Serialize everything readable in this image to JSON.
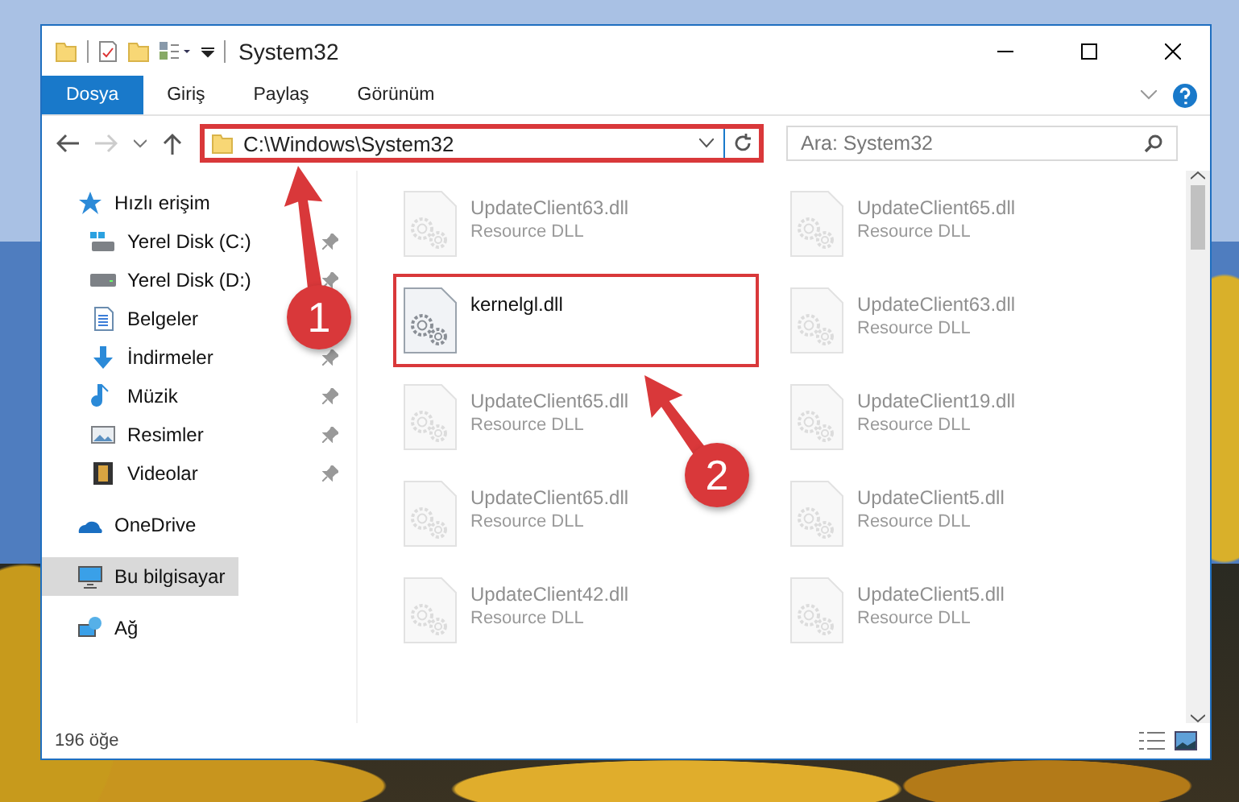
{
  "window": {
    "title": "System32"
  },
  "ribbon_tabs": [
    {
      "label": "Dosya",
      "selected": true
    },
    {
      "label": "Giriş",
      "selected": false
    },
    {
      "label": "Paylaş",
      "selected": false
    },
    {
      "label": "Görünüm",
      "selected": false
    }
  ],
  "address": {
    "path": "C:\\Windows\\System32",
    "highlighted": true
  },
  "search": {
    "placeholder": "Ara: System32"
  },
  "sidebar": {
    "items": [
      {
        "label": "Hızlı erişim",
        "kind": "star",
        "selected": false,
        "children": [
          {
            "label": "Yerel Disk (C:)",
            "kind": "system-drive",
            "pinned": true,
            "selected": false
          },
          {
            "label": "Yerel Disk (D:)",
            "kind": "drive",
            "pinned": true,
            "selected": false
          },
          {
            "label": "Belgeler",
            "kind": "document",
            "selected": false
          },
          {
            "label": "İndirmeler",
            "kind": "download",
            "pinned": true,
            "selected": false
          },
          {
            "label": "Müzik",
            "kind": "music",
            "pinned": true,
            "selected": false
          },
          {
            "label": "Resimler",
            "kind": "pictures",
            "pinned": true,
            "selected": false
          },
          {
            "label": "Videolar",
            "kind": "video",
            "pinned": true,
            "selected": false
          }
        ]
      },
      {
        "label": "OneDrive",
        "kind": "cloud",
        "selected": false
      },
      {
        "label": "Bu bilgisayar",
        "kind": "computer",
        "selected": true
      },
      {
        "label": "Ağ",
        "kind": "network",
        "selected": false
      }
    ]
  },
  "files": [
    {
      "name": "UpdateClient63.dll",
      "type": "Resource DLL",
      "highlighted": false
    },
    {
      "name": "UpdateClient65.dll",
      "type": "Resource DLL",
      "highlighted": false
    },
    {
      "name": "kernelgl.dll",
      "highlighted": true
    },
    {
      "name": "UpdateClient63.dll",
      "type": "Resource DLL",
      "highlighted": false
    },
    {
      "name": "UpdateClient65.dll",
      "type": "Resource DLL",
      "highlighted": false
    },
    {
      "name": "UpdateClient19.dll",
      "type": "Resource DLL",
      "highlighted": false
    },
    {
      "name": "UpdateClient65.dll",
      "type": "Resource DLL",
      "highlighted": false
    },
    {
      "name": "UpdateClient5.dll",
      "type": "Resource DLL",
      "highlighted": false
    },
    {
      "name": "UpdateClient42.dll",
      "type": "Resource DLL",
      "highlighted": false
    },
    {
      "name": "UpdateClient5.dll",
      "type": "Resource DLL",
      "highlighted": false
    }
  ],
  "status_bar": {
    "count": "196 öğe"
  },
  "callouts": [
    {
      "label": "1"
    },
    {
      "label": "2"
    }
  ]
}
